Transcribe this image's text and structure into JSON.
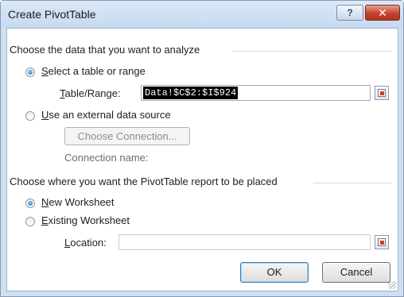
{
  "window": {
    "title": "Create PivotTable",
    "help_glyph": "?",
    "close_glyph": "✕"
  },
  "source": {
    "heading": "Choose the data that you want to analyze",
    "table_option": {
      "accel": "S",
      "rest": "elect a table or range",
      "selected": true
    },
    "table_range": {
      "accel": "T",
      "rest": "able/Range:",
      "value": "Data!$C$2:$I$924"
    },
    "external_option": {
      "accel": "U",
      "rest": "se an external data source",
      "selected": false
    },
    "choose_connection_label": "Choose Connection...",
    "connection_name_label": "Connection name:"
  },
  "placement": {
    "heading": "Choose where you want the PivotTable report to be placed",
    "new_option": {
      "accel": "N",
      "rest": "ew Worksheet",
      "selected": true
    },
    "existing_option": {
      "accel": "E",
      "rest": "xisting Worksheet",
      "selected": false
    },
    "location": {
      "accel": "L",
      "rest": "ocation:",
      "value": ""
    }
  },
  "buttons": {
    "ok": "OK",
    "cancel": "Cancel"
  },
  "icons": {
    "range_picker": "range-picker-icon",
    "help": "help-icon",
    "close": "close-icon"
  }
}
